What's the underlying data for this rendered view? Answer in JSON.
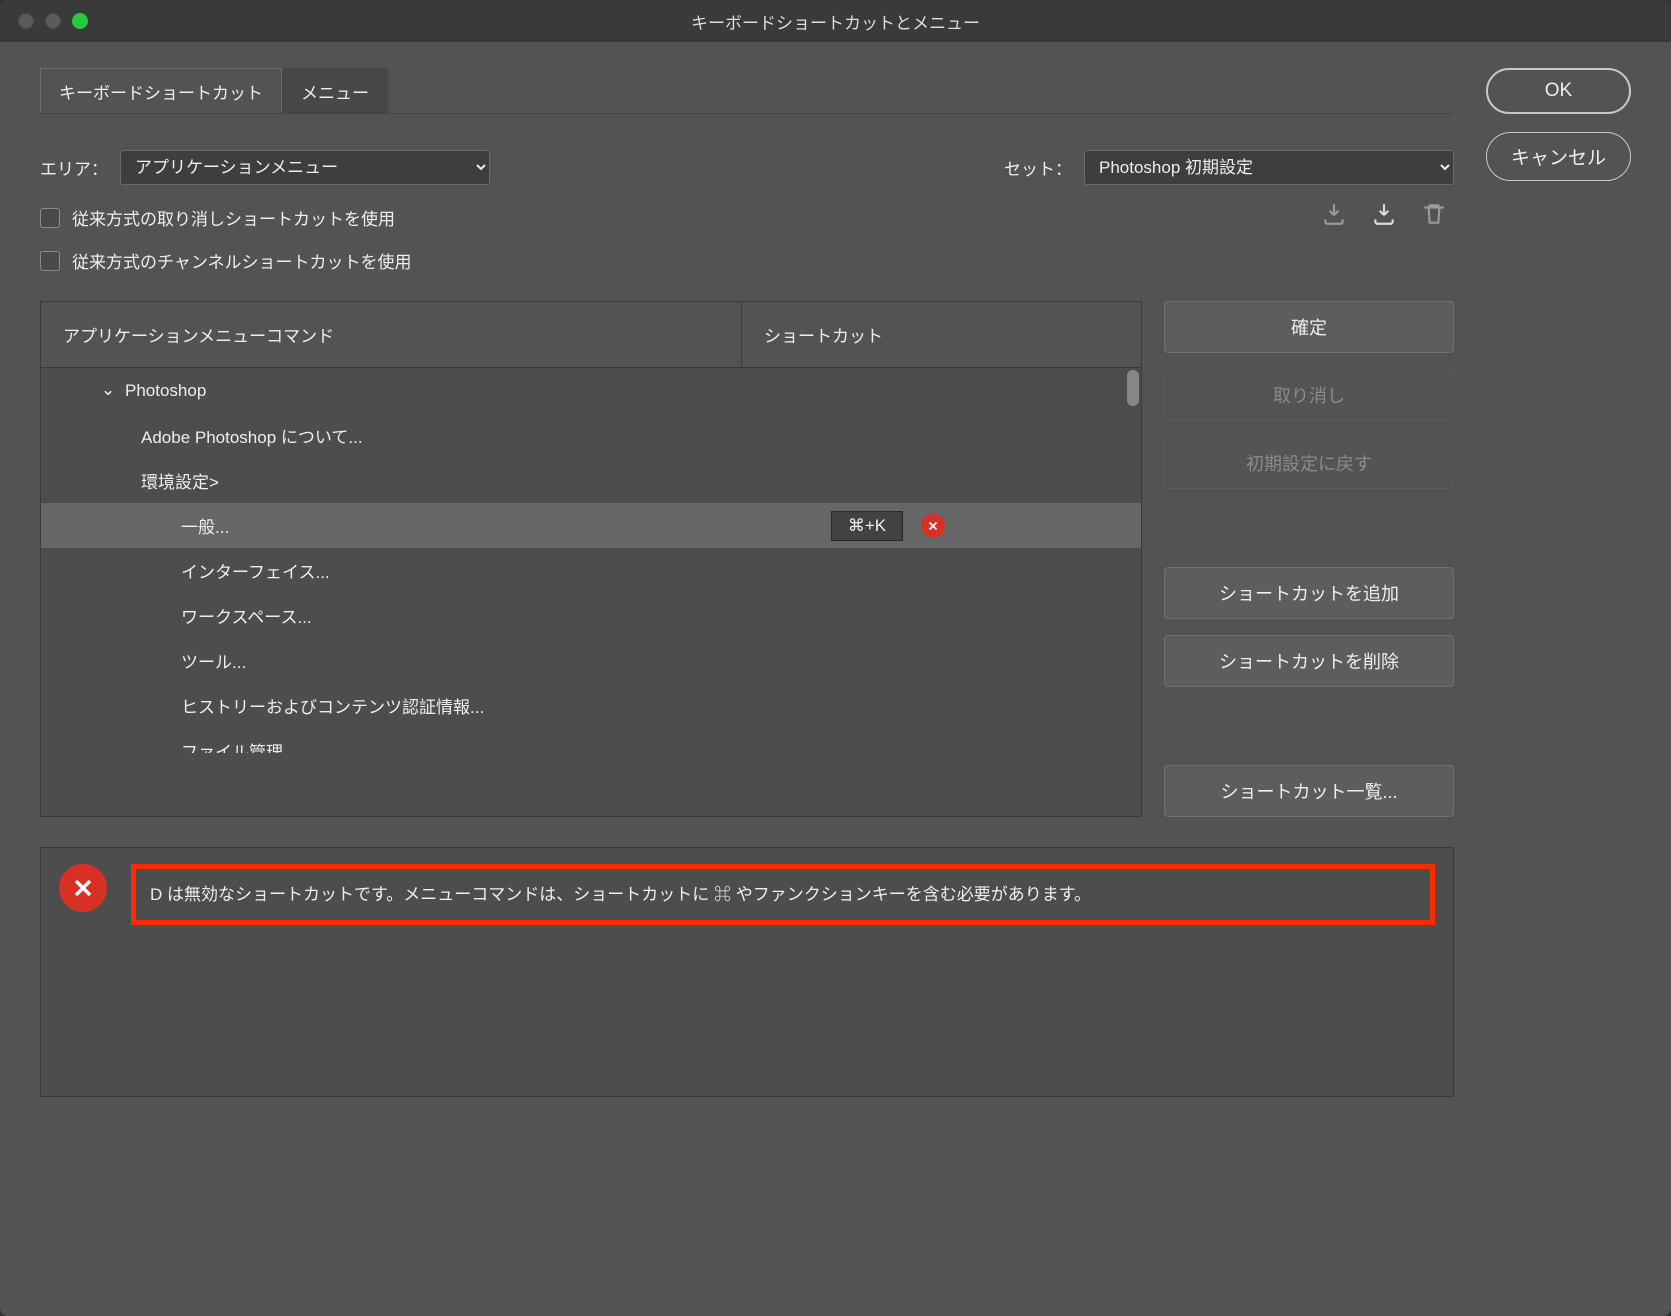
{
  "window": {
    "title": "キーボードショートカットとメニュー"
  },
  "tabs": {
    "shortcuts": "キーボードショートカット",
    "menus": "メニュー"
  },
  "area": {
    "label": "エリア：",
    "value": "アプリケーションメニュー"
  },
  "set": {
    "label": "セット：",
    "value": "Photoshop 初期設定"
  },
  "checkboxes": {
    "legacy_undo": "従来方式の取り消しショートカットを使用",
    "legacy_channel": "従来方式のチャンネルショートカットを使用"
  },
  "columns": {
    "command": "アプリケーションメニューコマンド",
    "shortcut": "ショートカット"
  },
  "tree": {
    "root": "Photoshop",
    "about": "Adobe Photoshop について...",
    "prefs": "環境設定>",
    "general": "一般...",
    "general_shortcut": "⌘+K",
    "interface": "インターフェイス...",
    "workspace": "ワークスペース...",
    "tools": "ツール...",
    "history": "ヒストリーおよびコンテンツ認証情報...",
    "filehandling": "ファイル管理..."
  },
  "actions": {
    "accept": "確定",
    "undo": "取り消し",
    "reset": "初期設定に戻す",
    "add": "ショートカットを追加",
    "delete": "ショートカットを削除",
    "summarize": "ショートカット一覧..."
  },
  "side": {
    "ok": "OK",
    "cancel": "キャンセル"
  },
  "error": {
    "message": "D は無効なショートカットです。メニューコマンドは、ショートカットに ⌘ やファンクションキーを含む必要があります。"
  }
}
